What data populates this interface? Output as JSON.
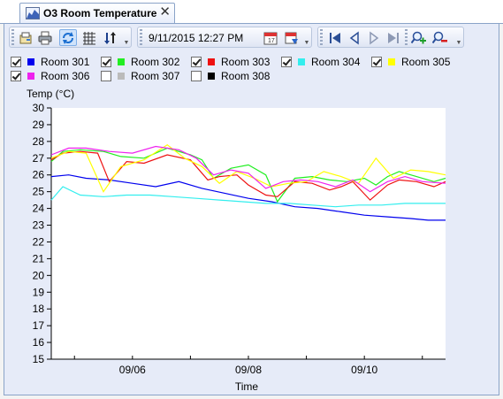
{
  "tab": {
    "title": "O3 Room Temperature",
    "icon": "chart-icon",
    "close_glyph": "✕"
  },
  "toolbar": {
    "buttons_left": [
      "properties-icon",
      "print-icon",
      "refresh-icon",
      "grid-icon",
      "sort-icon"
    ],
    "datetime_value": "9/11/2015 12:27 PM",
    "date_buttons": [
      "calendar-icon",
      "calendar-goto-icon"
    ],
    "nav_buttons": [
      "first-icon",
      "previous-icon",
      "next-icon",
      "last-icon"
    ],
    "zoom_buttons": [
      "zoom-in-icon",
      "zoom-out-icon"
    ]
  },
  "legend": [
    {
      "label": "Room 301",
      "checked": true,
      "color": "#0000ee"
    },
    {
      "label": "Room 302",
      "checked": true,
      "color": "#22ee22"
    },
    {
      "label": "Room 303",
      "checked": true,
      "color": "#ee1111"
    },
    {
      "label": "Room 304",
      "checked": true,
      "color": "#33eeee"
    },
    {
      "label": "Room 305",
      "checked": true,
      "color": "#ffff00"
    },
    {
      "label": "Room 306",
      "checked": true,
      "color": "#ee22ee"
    },
    {
      "label": "Room 307",
      "checked": false,
      "color": "#bbbbbb"
    },
    {
      "label": "Room 308",
      "checked": false,
      "color": "#000000"
    }
  ],
  "chart_data": {
    "type": "line",
    "ylabel": "Temp (°C)",
    "xlabel": "Time",
    "ylim": [
      15,
      30
    ],
    "yticks": [
      15,
      16,
      17,
      18,
      19,
      20,
      21,
      22,
      23,
      24,
      25,
      26,
      27,
      28,
      29,
      30
    ],
    "x_tick_labels": [
      "09/06",
      "09/08",
      "09/10"
    ],
    "x_day_range": [
      4.6,
      11.4
    ],
    "x_label_days": [
      6,
      8,
      10
    ],
    "x_minor_days": [
      5,
      6,
      7,
      8,
      9,
      10,
      11
    ],
    "series": [
      {
        "name": "Room 301",
        "color": "#0000ee",
        "x": [
          4.6,
          4.9,
          5.2,
          5.6,
          6.0,
          6.4,
          6.8,
          7.2,
          7.6,
          8.0,
          8.4,
          8.8,
          9.2,
          9.6,
          10.0,
          10.4,
          10.8,
          11.1,
          11.4
        ],
        "y": [
          25.9,
          26.0,
          25.8,
          25.7,
          25.5,
          25.3,
          25.6,
          25.2,
          24.9,
          24.6,
          24.4,
          24.1,
          24.0,
          23.8,
          23.6,
          23.5,
          23.4,
          23.3,
          23.3
        ]
      },
      {
        "name": "Room 302",
        "color": "#22ee22",
        "x": [
          4.6,
          4.8,
          5.1,
          5.5,
          5.8,
          6.2,
          6.6,
          7.0,
          7.2,
          7.4,
          7.7,
          8.0,
          8.3,
          8.5,
          8.8,
          9.1,
          9.4,
          9.7,
          10.0,
          10.2,
          10.4,
          10.6,
          10.9,
          11.2,
          11.4
        ],
        "y": [
          26.8,
          27.4,
          27.5,
          27.4,
          27.1,
          27.0,
          27.6,
          27.2,
          26.9,
          25.8,
          26.4,
          26.6,
          26.0,
          24.4,
          25.8,
          25.9,
          25.7,
          25.6,
          25.8,
          25.4,
          25.9,
          26.2,
          25.9,
          25.6,
          25.8
        ]
      },
      {
        "name": "Room 303",
        "color": "#ee1111",
        "x": [
          4.6,
          4.8,
          5.1,
          5.4,
          5.6,
          5.9,
          6.2,
          6.6,
          7.0,
          7.3,
          7.5,
          7.8,
          8.0,
          8.3,
          8.5,
          8.8,
          9.1,
          9.4,
          9.6,
          9.8,
          10.1,
          10.4,
          10.6,
          10.9,
          11.2,
          11.4
        ],
        "y": [
          26.9,
          27.3,
          27.4,
          27.3,
          25.6,
          26.8,
          26.7,
          27.2,
          26.9,
          25.7,
          25.9,
          26.0,
          25.4,
          24.8,
          24.7,
          25.6,
          25.5,
          25.1,
          25.3,
          25.6,
          24.5,
          25.4,
          25.7,
          25.6,
          25.3,
          25.6
        ]
      },
      {
        "name": "Room 304",
        "color": "#33eeee",
        "x": [
          4.6,
          4.8,
          5.1,
          5.5,
          5.9,
          6.3,
          6.7,
          7.1,
          7.5,
          7.9,
          8.3,
          8.7,
          9.1,
          9.5,
          9.9,
          10.3,
          10.7,
          11.1,
          11.4
        ],
        "y": [
          24.5,
          25.3,
          24.8,
          24.7,
          24.8,
          24.8,
          24.7,
          24.6,
          24.5,
          24.4,
          24.3,
          24.3,
          24.2,
          24.1,
          24.2,
          24.2,
          24.3,
          24.3,
          24.3
        ]
      },
      {
        "name": "Room 305",
        "color": "#ffff00",
        "x": [
          4.6,
          4.9,
          5.2,
          5.5,
          5.8,
          6.2,
          6.6,
          6.9,
          7.2,
          7.5,
          7.8,
          8.1,
          8.4,
          8.7,
          9.0,
          9.3,
          9.6,
          9.9,
          10.2,
          10.5,
          10.8,
          11.1,
          11.4
        ],
        "y": [
          27.0,
          27.4,
          27.3,
          25.0,
          26.5,
          26.9,
          27.8,
          27.0,
          26.5,
          25.5,
          26.2,
          25.8,
          25.3,
          25.5,
          25.6,
          26.2,
          25.9,
          25.5,
          27.0,
          25.8,
          26.3,
          26.2,
          26.0
        ]
      },
      {
        "name": "Room 306",
        "color": "#ee22ee",
        "x": [
          4.6,
          4.9,
          5.2,
          5.6,
          6.0,
          6.4,
          6.8,
          7.1,
          7.4,
          7.7,
          8.0,
          8.3,
          8.6,
          8.9,
          9.2,
          9.5,
          9.8,
          10.1,
          10.4,
          10.7,
          11.0,
          11.4
        ],
        "y": [
          27.2,
          27.6,
          27.6,
          27.4,
          27.3,
          27.7,
          27.5,
          27.0,
          26.0,
          26.3,
          26.1,
          25.2,
          25.6,
          25.7,
          25.6,
          25.3,
          25.7,
          25.0,
          25.6,
          25.9,
          25.6,
          25.5
        ]
      }
    ]
  }
}
